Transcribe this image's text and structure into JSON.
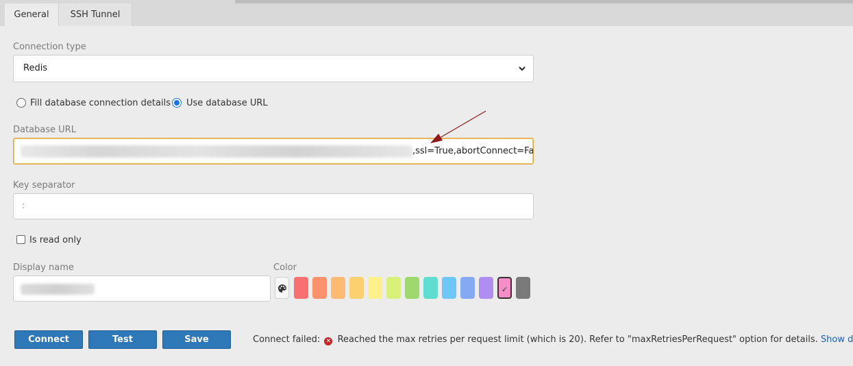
{
  "tabs": [
    {
      "label": "General",
      "active": true
    },
    {
      "label": "SSH Tunnel",
      "active": false
    }
  ],
  "connection_type": {
    "label": "Connection type",
    "value": "Redis"
  },
  "mode": {
    "options": [
      {
        "label": "Fill database connection details",
        "selected": false
      },
      {
        "label": "Use database URL",
        "selected": true
      }
    ]
  },
  "database_url": {
    "label": "Database URL",
    "visible_value": ",ssl=True,abortConnect=False",
    "redacted": true
  },
  "key_separator": {
    "label": "Key separator",
    "value": ":"
  },
  "read_only": {
    "label": "Is read only",
    "checked": false
  },
  "display_name": {
    "label": "Display name",
    "redacted": true
  },
  "color": {
    "label": "Color",
    "picker_icon": "palette-icon",
    "swatches": [
      "#f87171",
      "#fb926b",
      "#fdba74",
      "#fcd06e",
      "#fef08a",
      "#d9f07a",
      "#9ed76b",
      "#5eddd0",
      "#6ec6f7",
      "#86a9f4",
      "#b08ef0",
      "#f38fc6",
      "#7a7a7a"
    ],
    "selected_index": 11,
    "check_glyph": "✓"
  },
  "buttons": {
    "connect": "Connect",
    "test": "Test",
    "save": "Save"
  },
  "status": {
    "prefix": "Connect failed:",
    "error_icon": "x-circle-icon",
    "message": "Reached the max retries per request limit (which is 20). Refer to \"maxRetriesPerRequest\" option for details.",
    "link": "Show detail"
  },
  "annotation": {
    "color": "#8b1a1a"
  }
}
